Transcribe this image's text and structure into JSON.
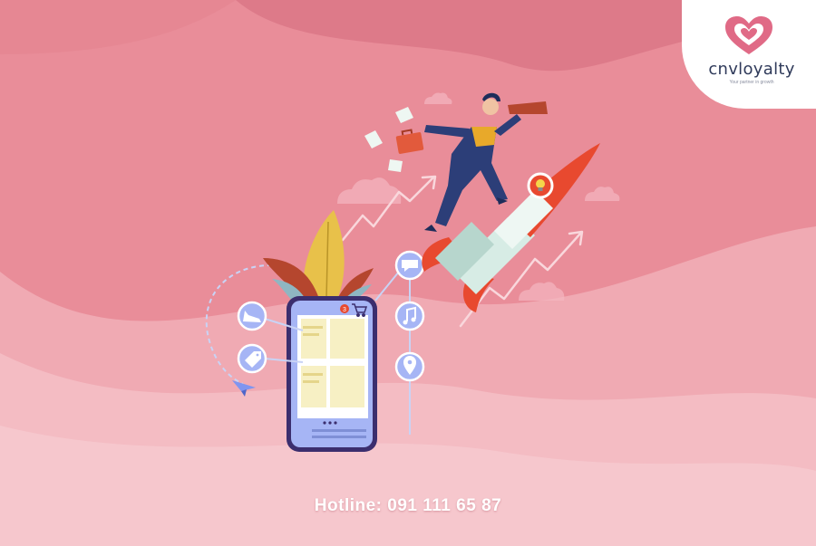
{
  "brand": {
    "name": "cnvloyalty",
    "tagline": "Your partner in growth"
  },
  "hotline": "Hotline: 091 111 65 87",
  "phone_screen": {
    "notification_count": "3"
  },
  "icons": [
    "shoe-icon",
    "price-tag-icon",
    "chat-bubble-icon",
    "music-note-icon",
    "location-pin-icon",
    "cart-icon",
    "lightbulb-icon",
    "paper-plane-icon"
  ],
  "colors": {
    "background": "#e98d99",
    "brand_text": "#2f3a5a",
    "brand_heart": "#e06a86",
    "phone_body": "#a6b5f5",
    "phone_outline": "#3b2e6e",
    "rocket_red": "#e8492f",
    "businessman_suit": "#2c3e78"
  }
}
